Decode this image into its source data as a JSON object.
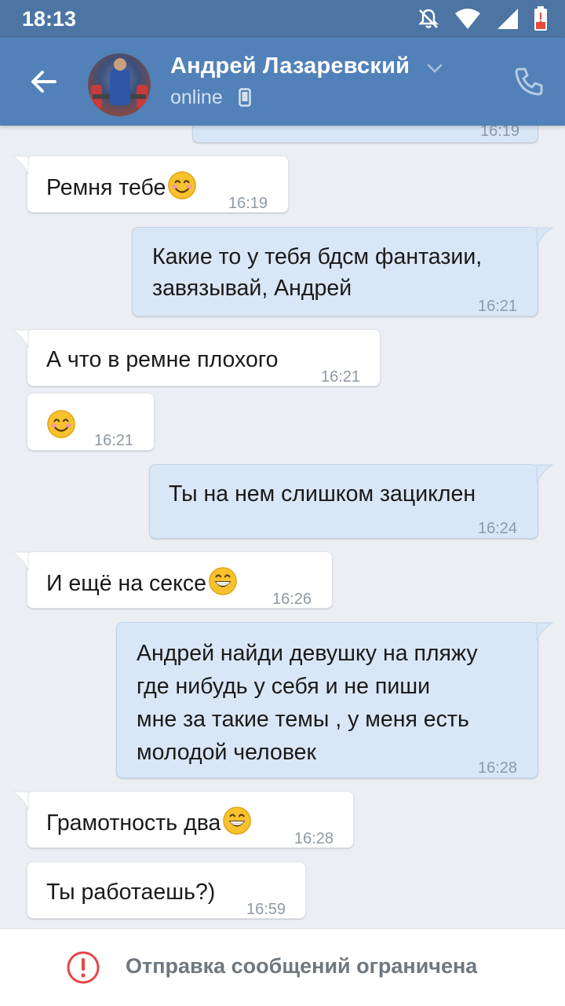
{
  "status_bar": {
    "time": "18:13",
    "icons": [
      "bell-off-icon",
      "wifi-icon",
      "cell-signal-icon",
      "battery-low-icon"
    ]
  },
  "header": {
    "contact_name": "Андрей Лазаревский",
    "status": "online",
    "back_icon": "back-arrow-icon",
    "call_icon": "phone-icon",
    "colors": {
      "header_bg": "#5181b8",
      "status_bar_bg": "#4c75a3"
    }
  },
  "messages": [
    {
      "direction": "out",
      "text": "",
      "time": "16:19",
      "partial": true
    },
    {
      "direction": "in",
      "text": "Ремня тебе",
      "emoji": "smiling-face-emoji",
      "time": "16:19"
    },
    {
      "direction": "out",
      "text": "Какие то у тебя бдсм фантазии,\nзавязывай, Андрей",
      "time": "16:21"
    },
    {
      "direction": "in",
      "text": "А что в ремне плохого",
      "time": "16:21"
    },
    {
      "direction": "in",
      "text": "",
      "emoji": "smiling-face-emoji",
      "time": "16:21"
    },
    {
      "direction": "out",
      "text": "Ты на нем слишком зациклен",
      "time": "16:24"
    },
    {
      "direction": "in",
      "text": "И ещё на сексе",
      "emoji": "grinning-face-emoji",
      "time": "16:26"
    },
    {
      "direction": "out",
      "text": "Андрей найди девушку на пляжу\nгде нибудь у себя и не пиши\nмне за такие темы , у меня есть\nмолодой человек",
      "time": "16:28"
    },
    {
      "direction": "in",
      "text": "Грамотность два",
      "emoji": "grinning-face-emoji",
      "time": "16:28"
    },
    {
      "direction": "in",
      "text": "Ты работаешь?)",
      "time": "16:59"
    }
  ],
  "footer": {
    "notice": "Отправка сообщений ограничена",
    "icon": "warning-circle-icon",
    "color": "#e64646"
  }
}
